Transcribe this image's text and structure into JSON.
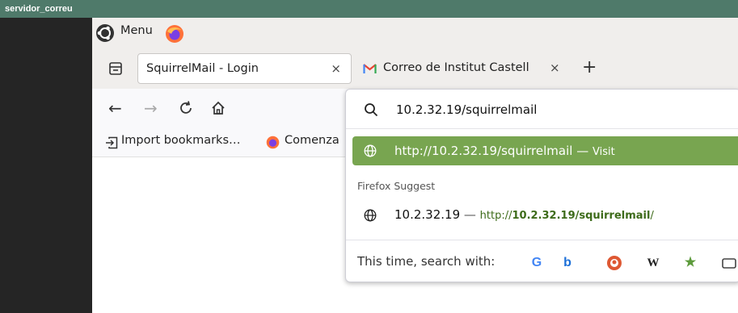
{
  "window": {
    "title": "servidor_correu"
  },
  "system_menu": {
    "label": "Menu"
  },
  "tabs": [
    {
      "label": "SquirrelMail - Login",
      "close": "×",
      "active": true
    },
    {
      "label": "Correo de Institut Castell",
      "close": "×",
      "active": false
    }
  ],
  "new_tab": "+",
  "nav": {
    "back": "←",
    "forward": "→"
  },
  "bookmarks": [
    {
      "label": "Import bookmarks…"
    },
    {
      "label": "Comenza"
    }
  ],
  "urlbar": {
    "value": "10.2.32.19/squirrelmail",
    "selected_result": {
      "url": "http://10.2.32.19/squirrelmail",
      "sep": "—",
      "action": "Visit"
    },
    "section_label": "Firefox Suggest",
    "suggestion": {
      "title": "10.2.32.19",
      "sep": "—",
      "url_prefix": "http://",
      "url_bold": "10.2.32.19/squirrelmail",
      "url_suffix": "/"
    },
    "search_with_label": "This time, search with:",
    "engines": [
      {
        "name": "google-icon",
        "glyph": "G",
        "color": "#4285f4"
      },
      {
        "name": "bing-icon",
        "glyph": "b",
        "color": "#1b6fd8"
      },
      {
        "name": "duckduckgo-icon",
        "glyph": "",
        "color": "#de5833"
      },
      {
        "name": "wikipedia-icon",
        "glyph": "W",
        "color": "#222222"
      },
      {
        "name": "bookmarks-star-icon",
        "glyph": "★",
        "color": "#5d9b3c"
      },
      {
        "name": "tabs-icon",
        "glyph": "",
        "color": "#444444"
      }
    ]
  },
  "colors": {
    "vm_title_bg": "#4f7a6a",
    "selected_row_bg": "#78a550",
    "url_green": "#3d6b1a"
  }
}
